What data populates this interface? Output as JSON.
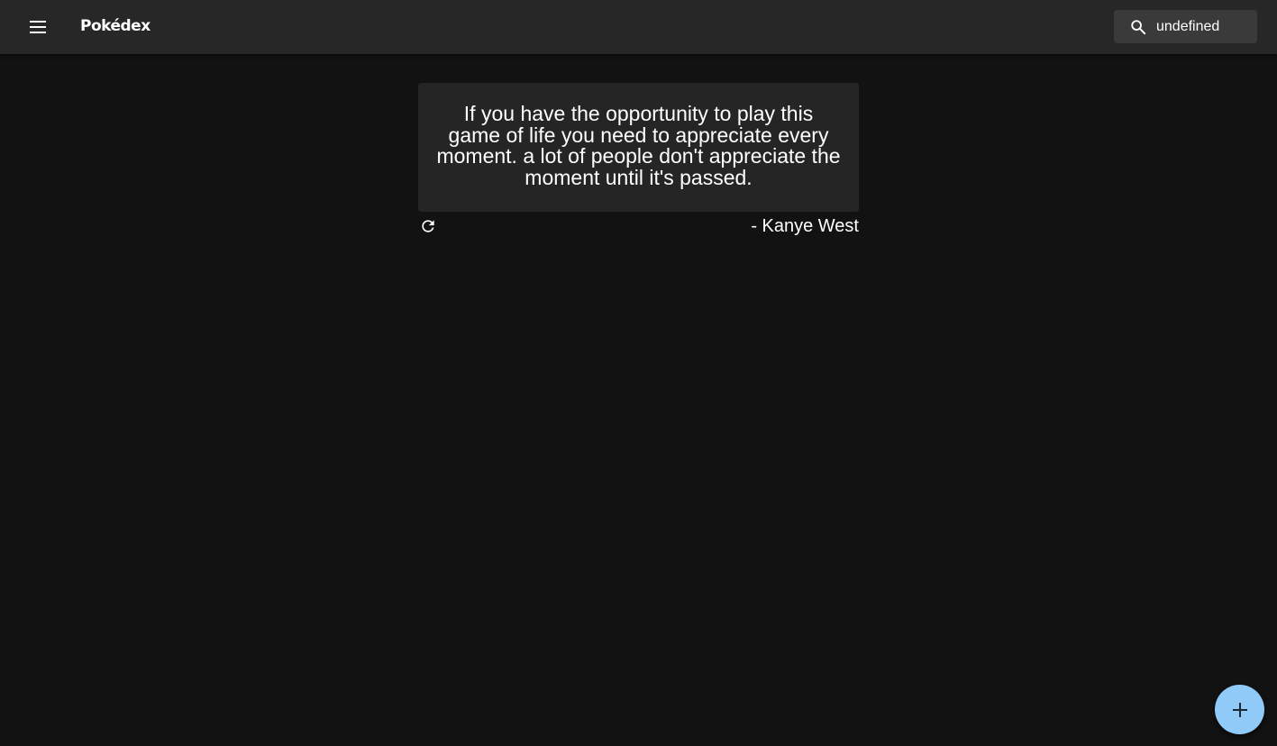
{
  "appbar": {
    "title": "Pokédex",
    "menu_icon": "menu-icon",
    "search": {
      "icon": "search-icon",
      "value": "undefined"
    }
  },
  "quote": {
    "text": "If you have the opportunity to play this game of life you need to appreciate every moment. a lot of people don't appreciate the moment until it's passed.",
    "author": "- Kanye West",
    "refresh_icon": "refresh-icon"
  },
  "fab": {
    "icon": "plus-icon",
    "color": "#90caf9"
  },
  "colors": {
    "background": "#121212",
    "appbar": "#272727",
    "card": "#252525",
    "search_bg": "#3a3a3a"
  }
}
